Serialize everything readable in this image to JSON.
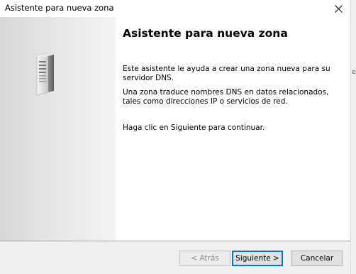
{
  "window": {
    "title": "Asistente para nueva zona",
    "close_icon": "close-icon"
  },
  "side": {
    "image": "server-tower-icon"
  },
  "main": {
    "heading": "Asistente para nueva zona",
    "paragraphs": [
      "Este asistente le ayuda a crear una zona nueva para su servidor DNS.",
      "Una zona traduce nombres DNS en datos relacionados, tales como direcciones IP o servicios de red.",
      "Haga clic en Siguiente para continuar."
    ]
  },
  "buttons": {
    "back": "< Atrás",
    "next": "Siguiente >",
    "cancel": "Cancelar"
  },
  "edge_text": "e"
}
